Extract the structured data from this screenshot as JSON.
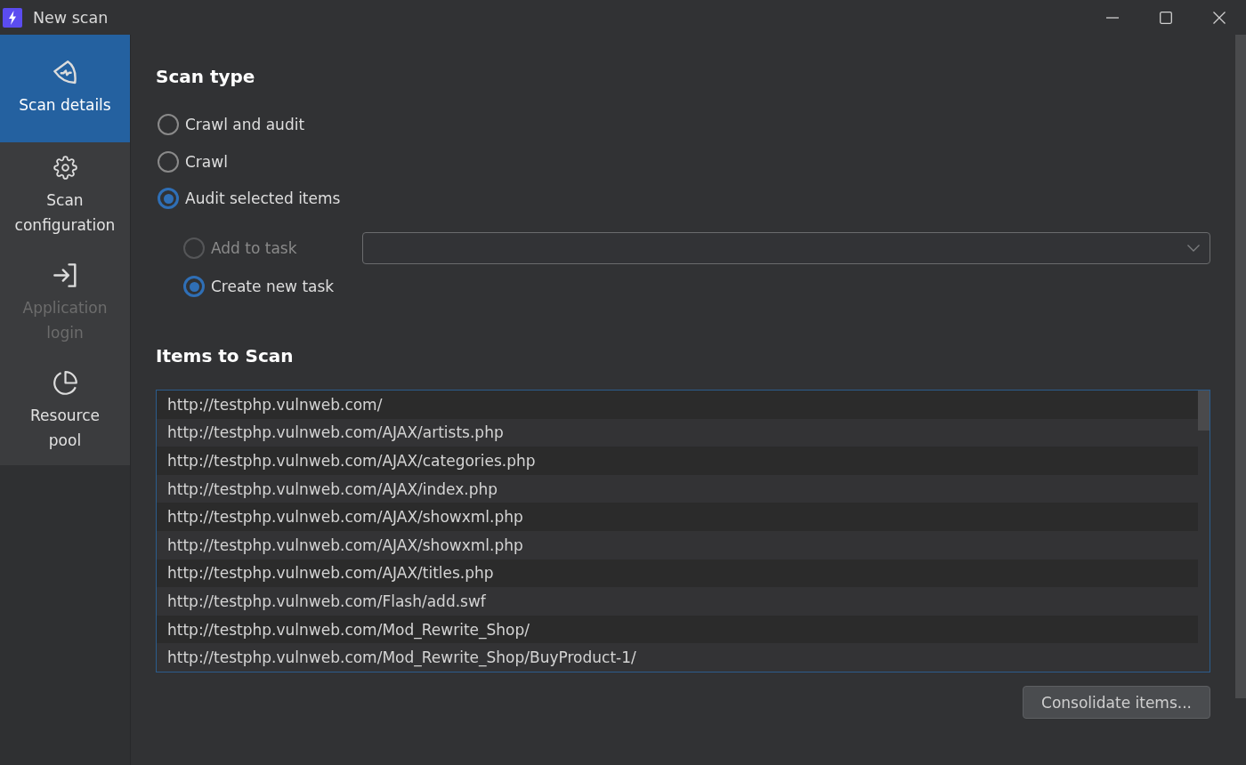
{
  "window": {
    "title": "New scan"
  },
  "sidebar": {
    "items": [
      {
        "label": "Scan details",
        "selected": true,
        "disabled": false
      },
      {
        "label": "Scan configuration",
        "selected": false,
        "disabled": false
      },
      {
        "label": "Application login",
        "selected": false,
        "disabled": true
      },
      {
        "label": "Resource pool",
        "selected": false,
        "disabled": false
      }
    ]
  },
  "scan_type": {
    "title": "Scan type",
    "options": [
      {
        "label": "Crawl and audit",
        "selected": false
      },
      {
        "label": "Crawl",
        "selected": false
      },
      {
        "label": "Audit selected items",
        "selected": true
      }
    ],
    "task_options": [
      {
        "label": "Add to task",
        "selected": false,
        "disabled": true
      },
      {
        "label": "Create new task",
        "selected": true,
        "disabled": false
      }
    ]
  },
  "items_to_scan": {
    "title": "Items to Scan",
    "rows": [
      "http://testphp.vulnweb.com/",
      "http://testphp.vulnweb.com/AJAX/artists.php",
      "http://testphp.vulnweb.com/AJAX/categories.php",
      "http://testphp.vulnweb.com/AJAX/index.php",
      "http://testphp.vulnweb.com/AJAX/showxml.php",
      "http://testphp.vulnweb.com/AJAX/showxml.php",
      "http://testphp.vulnweb.com/AJAX/titles.php",
      "http://testphp.vulnweb.com/Flash/add.swf",
      "http://testphp.vulnweb.com/Mod_Rewrite_Shop/",
      "http://testphp.vulnweb.com/Mod_Rewrite_Shop/BuyProduct-1/"
    ]
  },
  "buttons": [
    {
      "label": "Consolidate items..."
    }
  ]
}
